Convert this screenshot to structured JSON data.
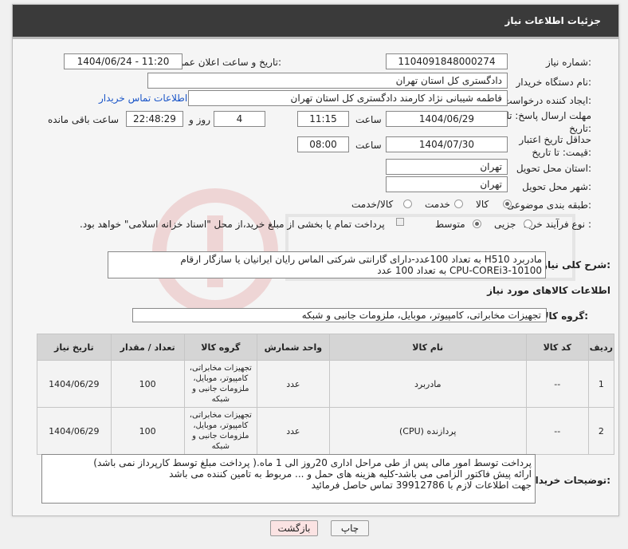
{
  "header": {
    "title": "جزئیات اطلاعات نیاز"
  },
  "fields": {
    "need_number_label": "شماره نیاز:",
    "need_number": "1104091848000274",
    "announce_label": "تاریخ و ساعت اعلان عمومی:",
    "announce_value": "1404/06/24 - 11:20",
    "buyer_org_label": "نام دستگاه خریدار:",
    "buyer_org": "دادگستری کل استان تهران",
    "requester_label": "ایجاد کننده درخواست:",
    "requester": "فاطمه شیبانی نژاد کارمند دادگستری کل استان تهران",
    "contact_link": "اطلاعات تماس خریدار",
    "reply_deadline_label": "مهلت ارسال پاسخ: تا تاریخ:",
    "reply_date": "1404/06/29",
    "time_word": "ساعت",
    "reply_time": "11:15",
    "days": "4",
    "days_word": "روز و",
    "remaining_time": "22:48:29",
    "remaining_word": "ساعت باقی مانده",
    "price_validity_label": "حداقل تاریخ اعتبار قیمت: تا تاریخ:",
    "validity_date": "1404/07/30",
    "validity_time": "08:00",
    "province_label": "استان محل تحویل:",
    "province": "تهران",
    "city_label": "شهر محل تحویل:",
    "city": "تهران",
    "category_label": "طبقه بندی موضوعی:",
    "category_options": [
      "کالا",
      "خدمت",
      "کالا/خدمت"
    ],
    "category_selected": "کالا",
    "process_label": "نوع فرآیند خرید :",
    "process_options": [
      "جزیی",
      "متوسط"
    ],
    "process_selected": "متوسط",
    "payment_note": "پرداخت تمام یا بخشی از مبلغ خرید،از محل \"اسناد خزانه اسلامی\" خواهد بود."
  },
  "description": {
    "label": "شرح کلی نیاز:",
    "line1": "مادربرد H510  به تعداد 100عدد-دارای گارانتی شرکتی الماس رایان ایرانیان یا سازگار ارقام",
    "line2": "CPU-COREi3-10100 به تعداد 100 عدد"
  },
  "goods": {
    "section_title": "اطلاعات کالاهای مورد نیاز",
    "group_label": "گروه کالا:",
    "group_value": "تجهیزات مخابراتی، کامپیوتر، موبایل، ملزومات جانبی و شبکه",
    "columns": [
      "ردیف",
      "کد کالا",
      "نام کالا",
      "واحد شمارش",
      "گروه کالا",
      "تعداد / مقدار",
      "تاریخ نیاز"
    ],
    "rows": [
      {
        "row": "1",
        "code": "--",
        "name": "مادربرد",
        "unit": "عدد",
        "group": "تجهیزات مخابراتی، کامپیوتر، موبایل، ملزومات جانبی و شبکه",
        "qty": "100",
        "date": "1404/06/29"
      },
      {
        "row": "2",
        "code": "--",
        "name": "پردازنده (CPU)",
        "unit": "عدد",
        "group": "تجهیزات مخابراتی، کامپیوتر، موبایل، ملزومات جانبی و شبکه",
        "qty": "100",
        "date": "1404/06/29"
      }
    ]
  },
  "buyer_notes": {
    "label": "توضیحات خریدار:",
    "line1": "پرداخت توسط امور مالی پس از طی مراحل اداری 20روز الی 1 ماه.( پرداخت مبلغ توسط کارپرداز نمی باشد)",
    "line2": "ارائه پیش فاکتور الزامی می باشد-کلیه هزینه های حمل و ... مربوط به تامین کننده می باشد",
    "line3": "جهت اطلاعات لازم با  39912786  تماس حاصل فرمائید"
  },
  "buttons": {
    "print": "چاپ",
    "back": "بازگشت"
  },
  "colors": {
    "header_bg": "#3a3a3a",
    "link": "#1a55c8",
    "table_head": "#d5d5d5"
  },
  "icons": {
    "select_arrow": "chevron-down-icon"
  }
}
